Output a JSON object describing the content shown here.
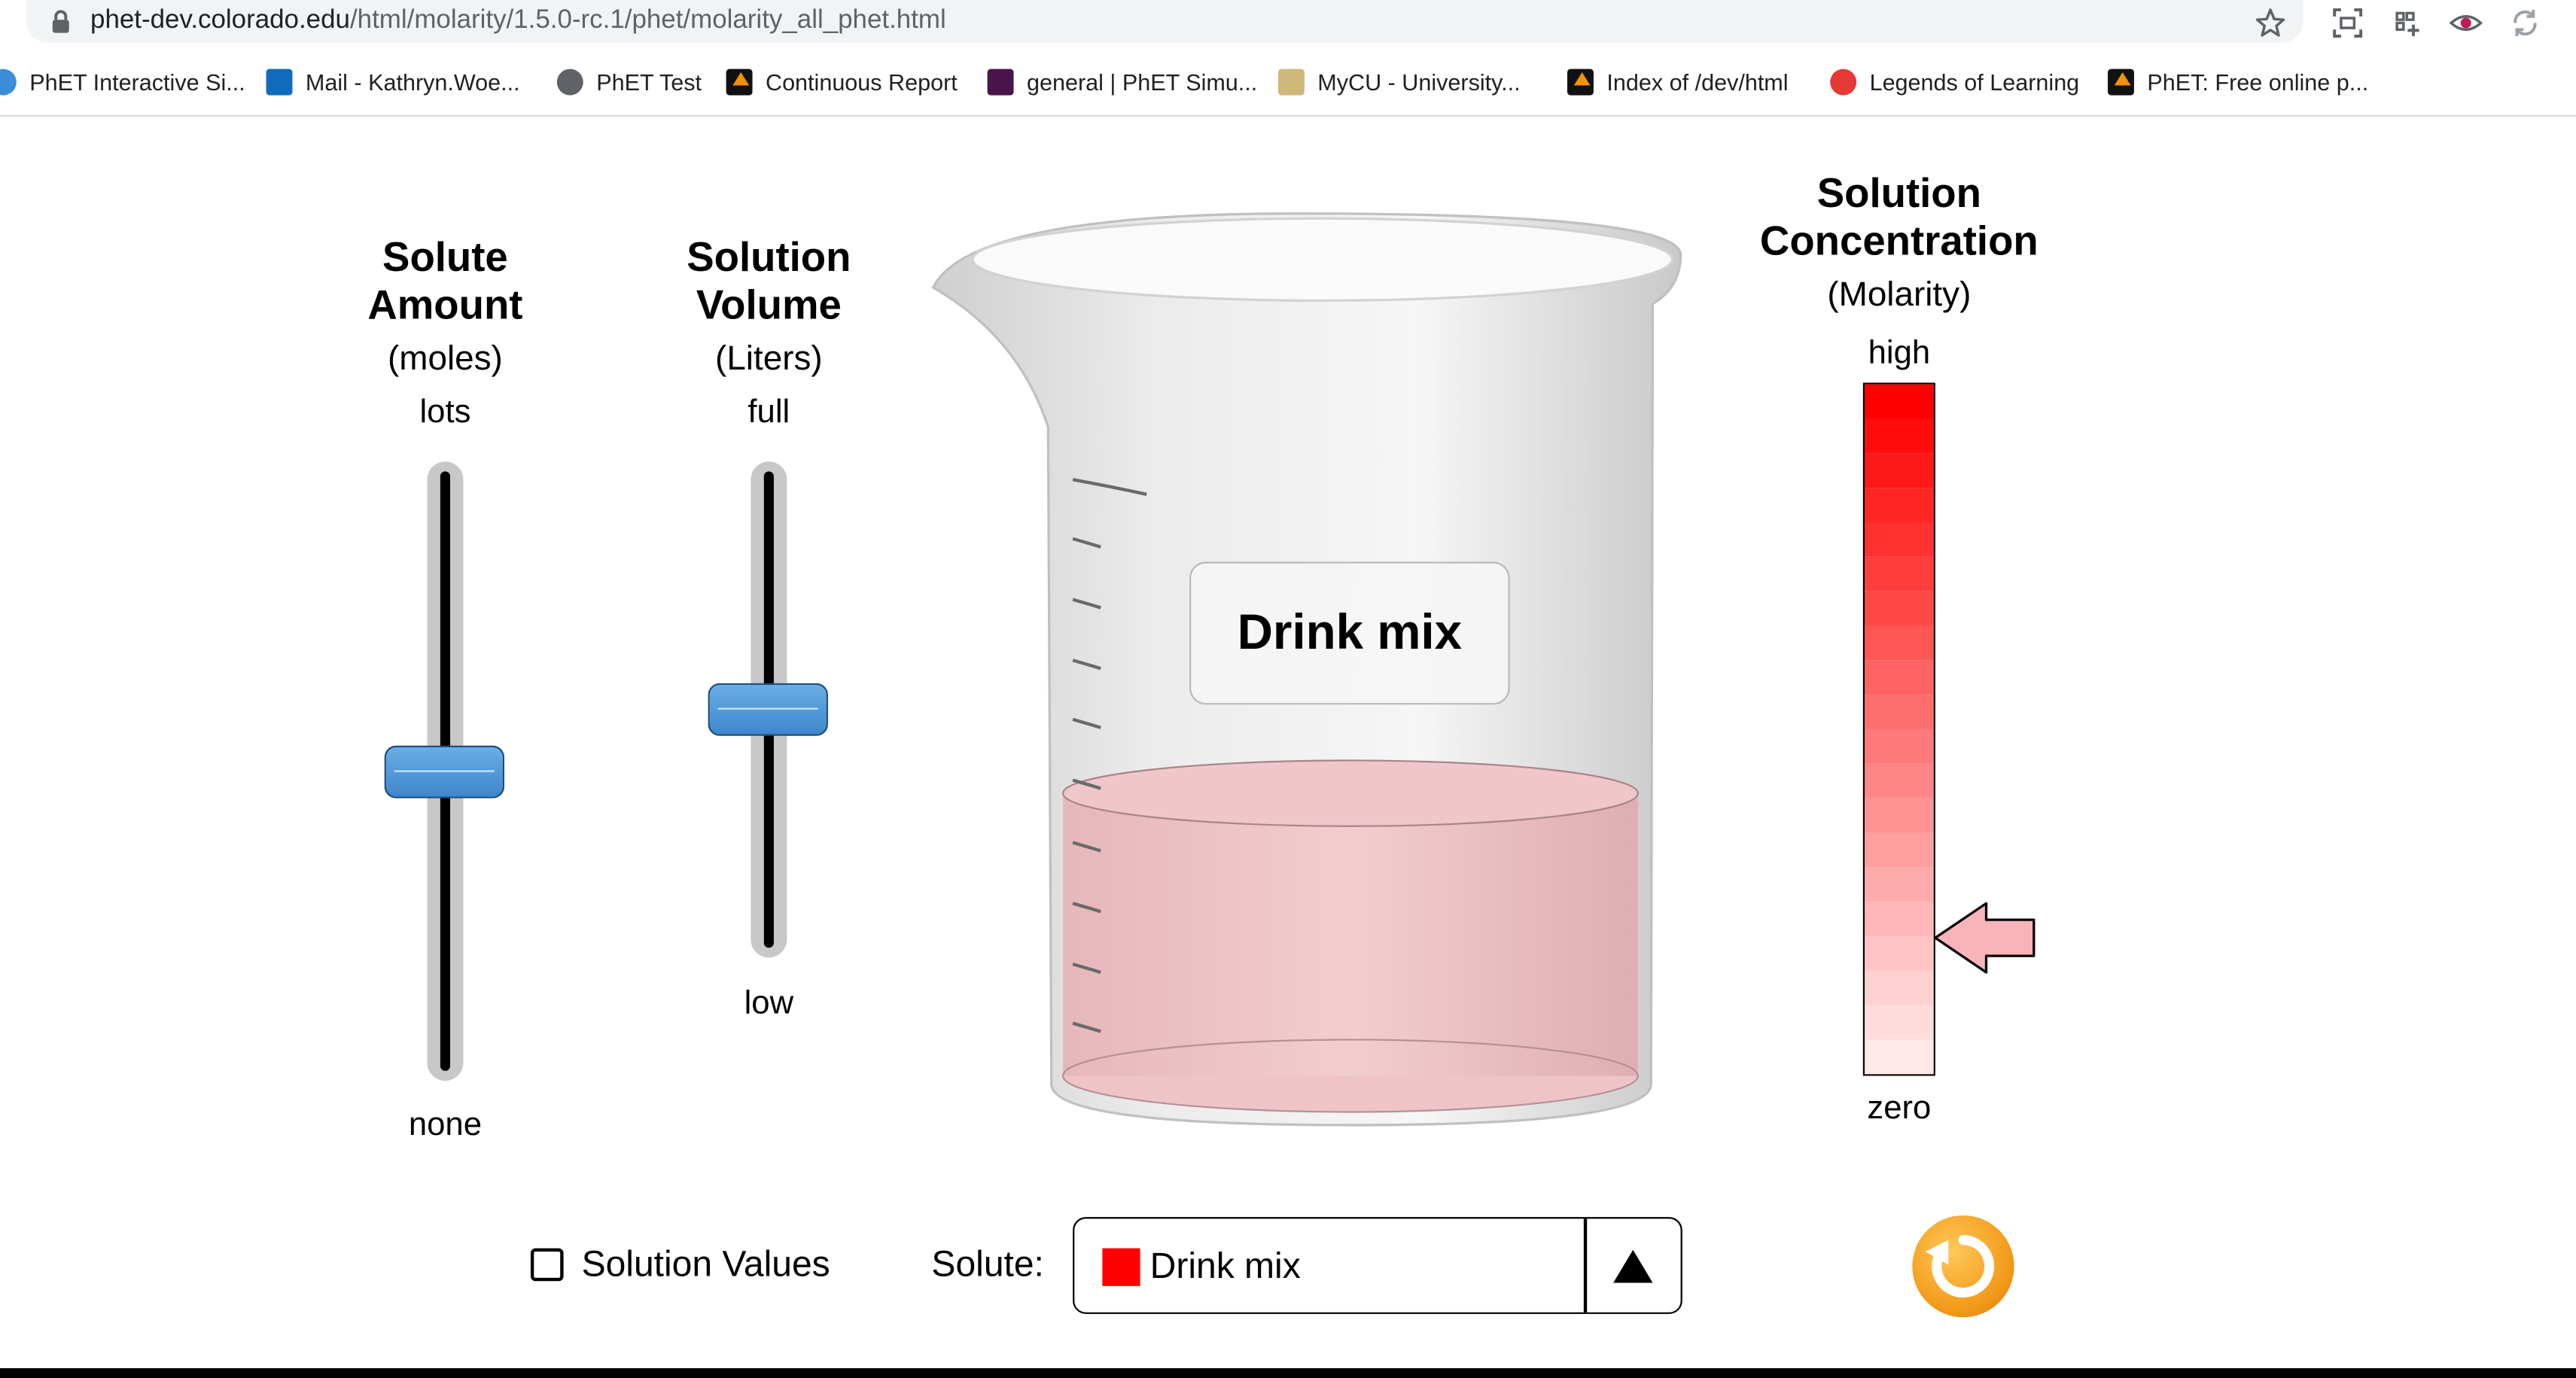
{
  "browser": {
    "url_host": "phet-dev.colorado.edu",
    "url_path": "/html/molarity/1.5.0-rc.1/phet/molarity_all_phet.html",
    "bookmarks": [
      {
        "label": "PhET Interactive Si...",
        "icon": "phet-globe-icon"
      },
      {
        "label": "Mail - Kathryn.Woe...",
        "icon": "outlook-icon"
      },
      {
        "label": "PhET Test",
        "icon": "globe-icon"
      },
      {
        "label": "Continuous Report",
        "icon": "phet-icon"
      },
      {
        "label": "general | PhET Simu...",
        "icon": "slack-icon"
      },
      {
        "label": "MyCU - University...",
        "icon": "cu-icon"
      },
      {
        "label": "Index of /dev/html",
        "icon": "phet-icon"
      },
      {
        "label": "Legends of Learning",
        "icon": "legends-icon"
      },
      {
        "label": "PhET: Free online p...",
        "icon": "phet-icon"
      }
    ]
  },
  "sim": {
    "solute_amount": {
      "title_line1": "Solute",
      "title_line2": "Amount",
      "units": "(moles)",
      "max_label": "lots",
      "min_label": "none",
      "value_fraction": 0.5
    },
    "solution_volume": {
      "title_line1": "Solution",
      "title_line2": "Volume",
      "units": "(Liters)",
      "max_label": "full",
      "min_label": "low",
      "value_fraction": 0.5
    },
    "beaker": {
      "label": "Drink mix",
      "fill_fraction": 0.5,
      "solution_color": "#f0c4c7"
    },
    "concentration": {
      "title_line1": "Solution",
      "title_line2": "Concentration",
      "units": "(Molarity)",
      "high_label": "high",
      "zero_label": "zero",
      "value_fraction": 0.2,
      "color_high": "#ff0000",
      "color_zero": "#ffe8e8"
    },
    "controls": {
      "solution_values_label": "Solution Values",
      "solution_values_checked": false,
      "solute_label": "Solute:",
      "solute_selected": "Drink mix",
      "solute_color": "#ff0000"
    }
  }
}
